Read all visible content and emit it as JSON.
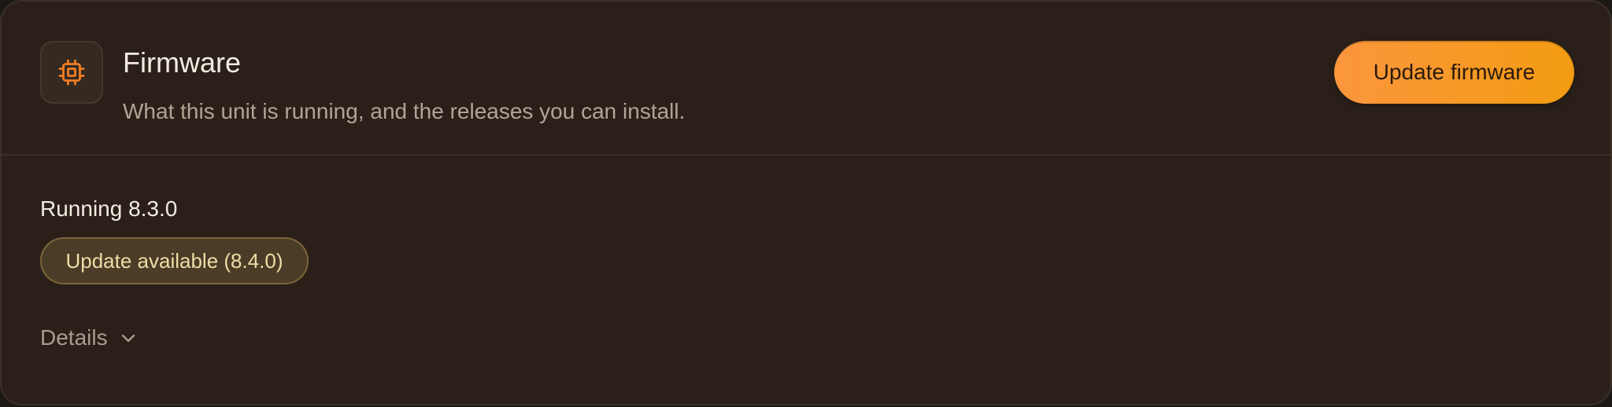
{
  "header": {
    "icon": "chip-icon",
    "title": "Firmware",
    "subtitle": "What this unit is running, and the releases you can install.",
    "update_button_label": "Update firmware"
  },
  "status": {
    "running_text": "Running 8.3.0",
    "update_badge_text": "Update available (8.4.0)"
  },
  "details": {
    "label": "Details",
    "icon": "chevron-down-icon"
  },
  "colors": {
    "accent_start": "#fb963d",
    "accent_end": "#f39c12",
    "card_background": "#2a2019",
    "badge_background": "#4a3c26",
    "badge_text": "#f0dca8",
    "chip_icon": "#f07c24"
  }
}
